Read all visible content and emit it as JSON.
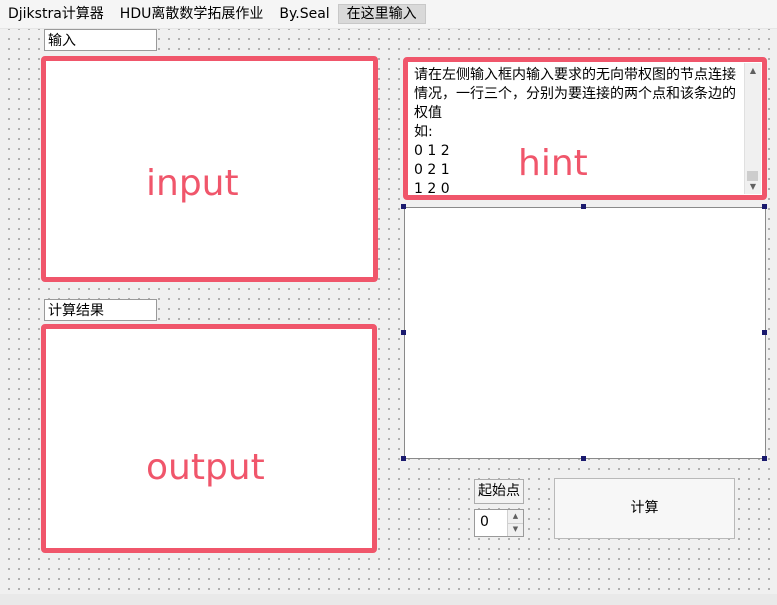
{
  "menubar": {
    "items": [
      "Djikstra计算器",
      "HDU离散数学拓展作业",
      "By.Seal",
      "在这里输入"
    ]
  },
  "input_section": {
    "label": "输入",
    "watermark": "input"
  },
  "output_section": {
    "label": "计算结果",
    "watermark": "output"
  },
  "hint_section": {
    "text": "请在左侧输入框内输入要求的无向带权图的节点连接情况，一行三个，分别为要连接的两个点和该条边的权值\n如:\n0 1 2\n0 2 1\n1 2 0",
    "watermark": "hint"
  },
  "start_node": {
    "label": "起始点",
    "value": "0"
  },
  "calc_button": {
    "label": "计算"
  },
  "colors": {
    "highlight": "#f0566b",
    "handle": "#1a1a6e"
  }
}
